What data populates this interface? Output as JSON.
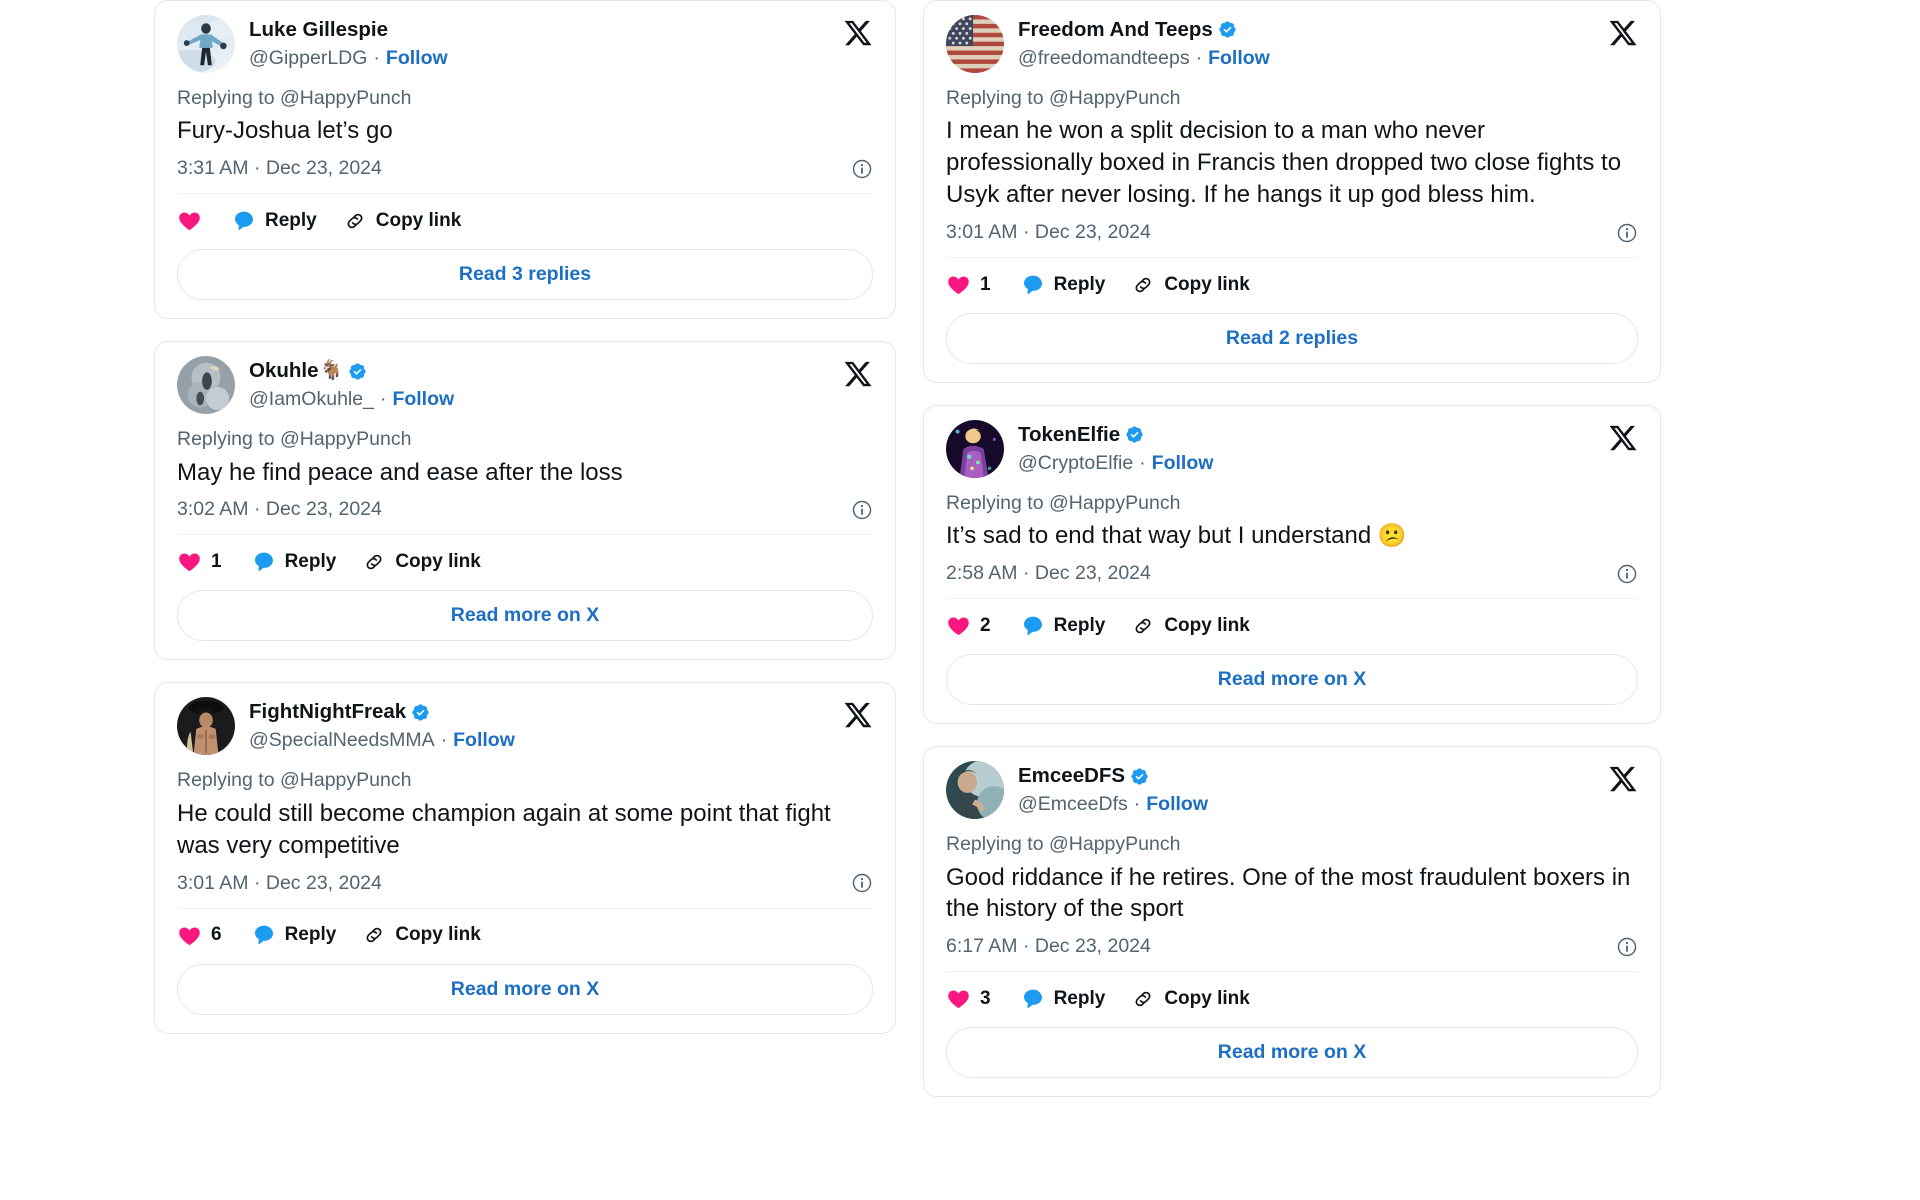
{
  "colors": {
    "accent_blue": "#1d9bf0",
    "link_blue": "#1d6fc4",
    "like_pink": "#f91880",
    "text_primary": "#0f1419",
    "text_secondary": "#536471",
    "card_border": "#e6e7e8",
    "background": "#ffffff"
  },
  "labels": {
    "reply": "Reply",
    "copy_link": "Copy link",
    "follow": "Follow",
    "separator": "·",
    "x_logo": "x-logo",
    "info_icon": "info-icon",
    "verified_icon": "verified-badge-icon",
    "like_icon": "heart-icon",
    "reply_icon": "comment-balloon-icon",
    "link_icon": "link-chain-icon"
  },
  "columns": {
    "left": [
      {
        "id": "luke-gillespie",
        "display_name": "Luke Gillespie",
        "name_emoji": "",
        "verified": false,
        "handle": "@GipperLDG",
        "follow_label": "Follow",
        "replying_to": "Replying to @HappyPunch",
        "text": "Fury-Joshua let’s go",
        "text_emoji": "",
        "timestamp": "3:31 AM · Dec 23, 2024",
        "like_count": "",
        "reply_label": "Reply",
        "copy_link_label": "Copy link",
        "read_label": "Read 3 replies",
        "avatar_type": "photo-snow"
      },
      {
        "id": "okuhle",
        "display_name": "Okuhle",
        "name_emoji": "🐐",
        "verified": true,
        "handle": "@IamOkuhle_",
        "follow_label": "Follow",
        "replying_to": "Replying to @HappyPunch",
        "text": "May he find peace and ease after the loss",
        "text_emoji": "",
        "timestamp": "3:02 AM · Dec 23, 2024",
        "like_count": "1",
        "reply_label": "Reply",
        "copy_link_label": "Copy link",
        "read_label": "Read more on X",
        "avatar_type": "photo-gray"
      },
      {
        "id": "fightnightfreak",
        "display_name": "FightNightFreak",
        "name_emoji": "",
        "verified": true,
        "handle": "@SpecialNeedsMMA",
        "follow_label": "Follow",
        "replying_to": "Replying to @HappyPunch",
        "text": "He could still become champion again at some point that fight was very competitive",
        "text_emoji": "",
        "timestamp": "3:01 AM · Dec 23, 2024",
        "like_count": "6",
        "reply_label": "Reply",
        "copy_link_label": "Copy link",
        "read_label": "Read more on X",
        "avatar_type": "photo-dark"
      }
    ],
    "right": [
      {
        "id": "freedom-and-teeps",
        "display_name": "Freedom And Teeps",
        "name_emoji": "",
        "verified": true,
        "handle": "@freedomandteeps",
        "follow_label": "Follow",
        "replying_to": "Replying to @HappyPunch",
        "text": "I mean he won a split decision to a man who never professionally boxed in Francis then dropped two close fights to Usyk after never losing. If he hangs it up god bless him.",
        "text_emoji": "",
        "timestamp": "3:01 AM · Dec 23, 2024",
        "like_count": "1",
        "reply_label": "Reply",
        "copy_link_label": "Copy link",
        "read_label": "Read 2 replies",
        "avatar_type": "flag-usa"
      },
      {
        "id": "tokenelfie",
        "display_name": "TokenElfie",
        "name_emoji": "",
        "verified": true,
        "handle": "@CryptoElfie",
        "follow_label": "Follow",
        "replying_to": "Replying to @HappyPunch",
        "text": "It’s sad to end that way but I understand ",
        "text_emoji": "😕",
        "timestamp": "2:58 AM · Dec 23, 2024",
        "like_count": "2",
        "reply_label": "Reply",
        "copy_link_label": "Copy link",
        "read_label": "Read more on X",
        "avatar_type": "photo-purple"
      },
      {
        "id": "emceedfs",
        "display_name": "EmceeDFS",
        "name_emoji": "",
        "verified": true,
        "handle": "@EmceeDfs",
        "follow_label": "Follow",
        "replying_to": "Replying to @HappyPunch",
        "text": "Good riddance if he retires.  One of the most fraudulent boxers in the history of the sport",
        "text_emoji": "",
        "timestamp": "6:17 AM · Dec 23, 2024",
        "like_count": "3",
        "reply_label": "Reply",
        "copy_link_label": "Copy link",
        "read_label": "Read more on X",
        "avatar_type": "photo-teal"
      }
    ]
  }
}
